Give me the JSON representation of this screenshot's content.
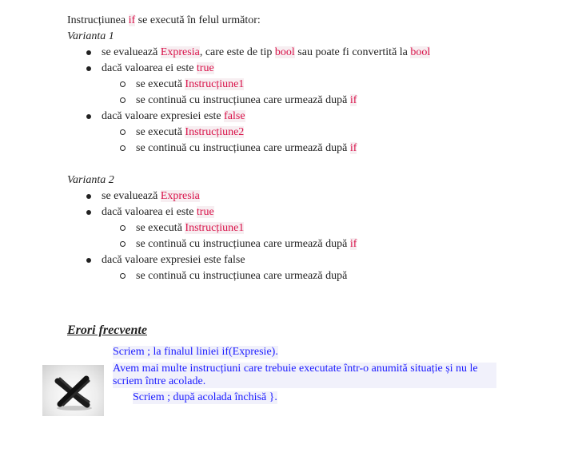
{
  "intro": {
    "pre": "Instrucțiunea ",
    "kw": "if",
    "post": " se execută în felul următor:"
  },
  "variant1": {
    "title": "Varianta 1",
    "b1": {
      "a": "se evaluează ",
      "k1": "Expresia",
      "b": ", care este de tip ",
      "k2": "bool",
      "c": " sau poate fi convertită la ",
      "k3": "bool"
    },
    "b2": {
      "a": "dacă valoarea ei este ",
      "k": "true"
    },
    "b2s1": {
      "a": "se execută ",
      "k": "Instrucțiune1"
    },
    "b2s2": {
      "a": "se continuă cu instrucțiunea care urmează după ",
      "k": "if"
    },
    "b3": {
      "a": "dacă valoare expresiei este ",
      "k": "false"
    },
    "b3s1": {
      "a": "se execută ",
      "k": "Instrucțiune2"
    },
    "b3s2": {
      "a": "se continuă cu instrucțiunea care urmează după ",
      "k": "if"
    }
  },
  "variant2": {
    "title": "Varianta 2",
    "b1": {
      "a": "se evaluează ",
      "k": "Expresia"
    },
    "b2": {
      "a": "dacă valoarea ei este ",
      "k": "true"
    },
    "b2s1": {
      "a": "se execută ",
      "k": "Instrucțiune1"
    },
    "b2s2": {
      "a": "se continuă cu instrucțiunea care urmează după ",
      "k": "if"
    },
    "b3": {
      "a": "dacă valoare expresiei este false"
    },
    "b3s1": {
      "a": "se continuă cu instrucțiunea care urmează după"
    }
  },
  "errors": {
    "heading": "Erori frecvente",
    "icon": "x-mark-icon",
    "items": [
      "Scriem ; la finalul liniei if(Expresie).",
      "Avem mai multe instrucțiuni care trebuie executate într-o anumită situație și nu le scriem între acolade.",
      "Scriem ; după acolada închisă }."
    ]
  },
  "colors": {
    "keyword": "#d9134a",
    "error_text": "#1a1aff",
    "text": "#222222"
  }
}
